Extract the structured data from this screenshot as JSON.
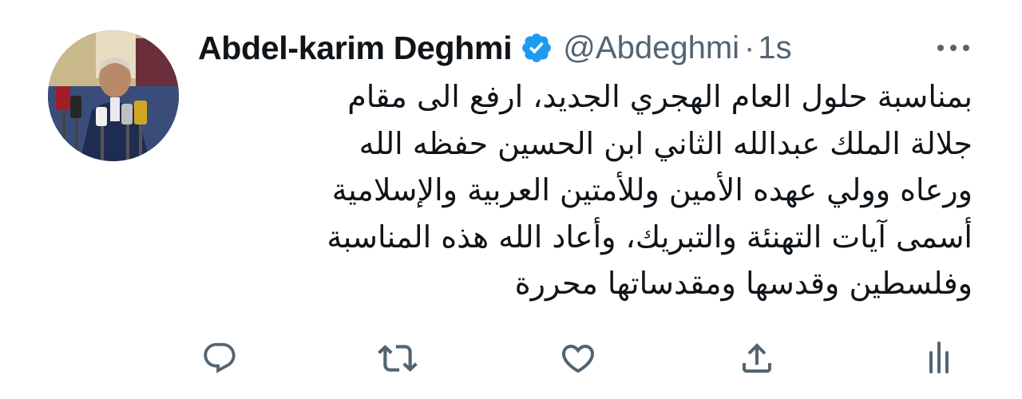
{
  "tweet": {
    "author": {
      "display_name": "Abdel-karim Deghmi",
      "handle": "@Abdeghmi",
      "verified": true
    },
    "separator": "·",
    "timestamp": "1s",
    "text_lines": [
      "بمناسبة حلول العام الهجري الجديد، ارفع الى مقام",
      "جلالة الملك عبدالله الثاني ابن الحسين حفظه الله",
      "ورعاه وولي عهده الأمين وللأمتين العربية والإسلامية",
      "أسمى آيات التهنئة والتبريك، وأعاد الله هذه المناسبة",
      "وفلسطين وقدسها ومقدساتها محررة"
    ]
  },
  "icons": {
    "verified": "verified-badge-icon",
    "more": "more-horizontal-icon",
    "reply": "reply-icon",
    "retweet": "retweet-icon",
    "like": "heart-icon",
    "share": "share-icon",
    "analytics": "analytics-icon"
  },
  "colors": {
    "text_primary": "#0f1419",
    "text_secondary": "#536471",
    "verified_blue": "#1d9bf0",
    "icon_gray": "#536471"
  }
}
